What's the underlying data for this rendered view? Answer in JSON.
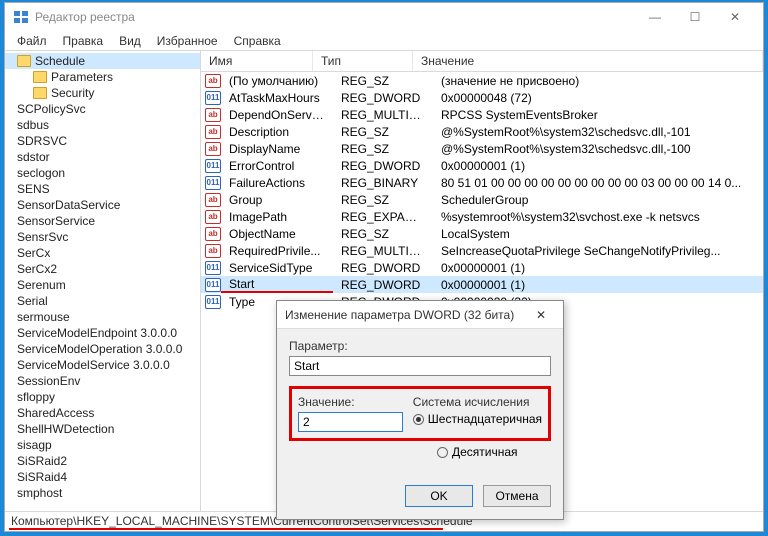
{
  "window": {
    "title": "Редактор реестра"
  },
  "menu": {
    "file": "Файл",
    "edit": "Правка",
    "view": "Вид",
    "favorites": "Избранное",
    "help": "Справка"
  },
  "tree": {
    "selected": "Schedule",
    "children": [
      "Parameters",
      "Security"
    ],
    "siblings": [
      "SCPolicySvc",
      "sdbus",
      "SDRSVC",
      "sdstor",
      "seclogon",
      "SENS",
      "SensorDataService",
      "SensorService",
      "SensrSvc",
      "SerCx",
      "SerCx2",
      "Serenum",
      "Serial",
      "sermouse",
      "ServiceModelEndpoint 3.0.0.0",
      "ServiceModelOperation 3.0.0.0",
      "ServiceModelService 3.0.0.0",
      "SessionEnv",
      "sfloppy",
      "SharedAccess",
      "ShellHWDetection",
      "sisagp",
      "SiSRaid2",
      "SiSRaid4",
      "smphost"
    ]
  },
  "columns": {
    "name": "Имя",
    "type": "Тип",
    "value": "Значение"
  },
  "rows": [
    {
      "icon": "str",
      "name": "(По умолчанию)",
      "type": "REG_SZ",
      "value": "(значение не присвоено)"
    },
    {
      "icon": "bin",
      "name": "AtTaskMaxHours",
      "type": "REG_DWORD",
      "value": "0x00000048 (72)"
    },
    {
      "icon": "str",
      "name": "DependOnService",
      "type": "REG_MULTI_SZ",
      "value": "RPCSS SystemEventsBroker"
    },
    {
      "icon": "str",
      "name": "Description",
      "type": "REG_SZ",
      "value": "@%SystemRoot%\\system32\\schedsvc.dll,-101"
    },
    {
      "icon": "str",
      "name": "DisplayName",
      "type": "REG_SZ",
      "value": "@%SystemRoot%\\system32\\schedsvc.dll,-100"
    },
    {
      "icon": "bin",
      "name": "ErrorControl",
      "type": "REG_DWORD",
      "value": "0x00000001 (1)"
    },
    {
      "icon": "bin",
      "name": "FailureActions",
      "type": "REG_BINARY",
      "value": "80 51 01 00 00 00 00 00 00 00 00 00 03 00 00 00 14 0..."
    },
    {
      "icon": "str",
      "name": "Group",
      "type": "REG_SZ",
      "value": "SchedulerGroup"
    },
    {
      "icon": "str",
      "name": "ImagePath",
      "type": "REG_EXPAND_SZ",
      "value": "%systemroot%\\system32\\svchost.exe -k netsvcs"
    },
    {
      "icon": "str",
      "name": "ObjectName",
      "type": "REG_SZ",
      "value": "LocalSystem"
    },
    {
      "icon": "str",
      "name": "RequiredPrivile...",
      "type": "REG_MULTI_SZ",
      "value": "SeIncreaseQuotaPrivilege SeChangeNotifyPrivileg..."
    },
    {
      "icon": "bin",
      "name": "ServiceSidType",
      "type": "REG_DWORD",
      "value": "0x00000001 (1)"
    },
    {
      "icon": "bin",
      "name": "Start",
      "type": "REG_DWORD",
      "value": "0x00000001 (1)",
      "selected": true,
      "underline": true
    },
    {
      "icon": "bin",
      "name": "Type",
      "type": "REG_DWORD",
      "value": "0x00000020 (32)"
    }
  ],
  "dialog": {
    "title": "Изменение параметра DWORD (32 бита)",
    "param_label": "Параметр:",
    "param_value": "Start",
    "value_label": "Значение:",
    "value": "2",
    "base_label": "Система исчисления",
    "hex": "Шестнадцатеричная",
    "dec": "Десятичная",
    "ok": "OK",
    "cancel": "Отмена"
  },
  "statusbar": "Компьютер\\HKEY_LOCAL_MACHINE\\SYSTEM\\CurrentControlSet\\Services\\Schedule"
}
